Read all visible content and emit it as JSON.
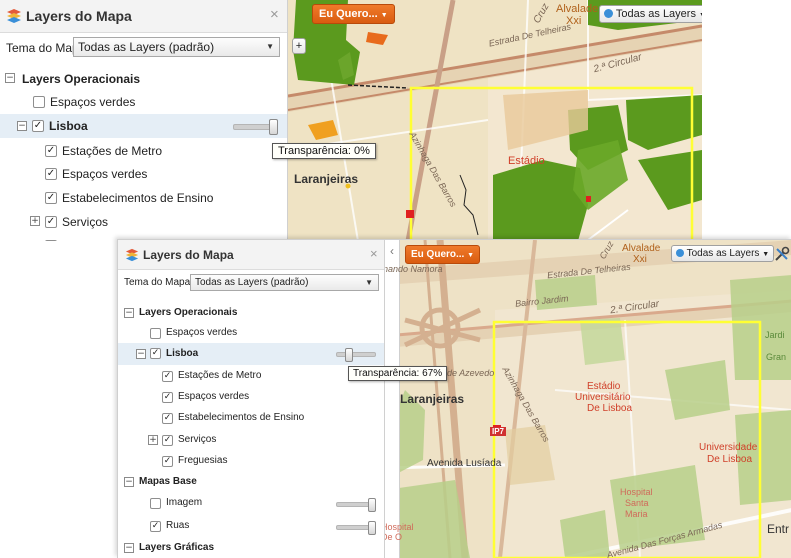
{
  "panel": {
    "title": "Layers do Mapa",
    "close": "×",
    "theme_label": "Tema do Mapa:",
    "theme_value": "Todas as Layers (padrão)"
  },
  "tree": {
    "operational": "Layers Operacionais",
    "espacos_verdes": "Espaços verdes",
    "lisboa": "Lisboa",
    "metro": "Estações de Metro",
    "lisboa_espacos": "Espaços verdes",
    "ensino": "Estabelecimentos de Ensino",
    "servicos": "Serviços",
    "freguesias": "Freguesias",
    "base": "Mapas Base",
    "imagem": "Imagem",
    "ruas": "Ruas",
    "graficas": "Layers Gráficas"
  },
  "tooltip1": "Transparência: 0%",
  "tooltip2": "Transparência: 67%",
  "transparency": {
    "first": 0,
    "second": 67
  },
  "toolbar": {
    "eu_quero": "Eu Quero...",
    "layers_dropdown": "Todas as Layers",
    "collapse": "‹",
    "caret": "▼"
  },
  "map": {
    "laranjeiras": "Laranjeiras",
    "alvalade": "Alvalade",
    "xxi": "Xxi",
    "estadio": "Estádio",
    "estadio_univ_1": "Estádio",
    "estadio_univ_2": "Universitário",
    "estadio_univ_3": "De Lisboa",
    "univ_1": "Universidade",
    "univ_2": "De Lisboa",
    "hospital_1": "Hospital",
    "hospital_2": "Santa",
    "hospital_3": "Maria",
    "circular": "2.ª Circular",
    "bairro_jardim": "Bairro Jardim",
    "avenida_lusiada": "Avenida Lusíada",
    "ip7": "IP7",
    "estrada_telheiras": "Estrada De Telheiras",
    "nando_namora": "nando Namora",
    "entr": "Entr",
    "cruz": "Cruz",
    "az_barros": "Azinhaga Das Barros",
    "f_azevedo": "de Azevedo",
    "forcas_armadas": "Avenida Das Forças Armadas",
    "gran": "Gran",
    "jardi": "Jardi",
    "hospital_d": "Hospital De O"
  },
  "colors": {
    "orange": "#e8691c",
    "green_park": "#5b9a1e",
    "highlight_yellow": "#ffff33",
    "tree_highlight": "#e5eef6"
  }
}
